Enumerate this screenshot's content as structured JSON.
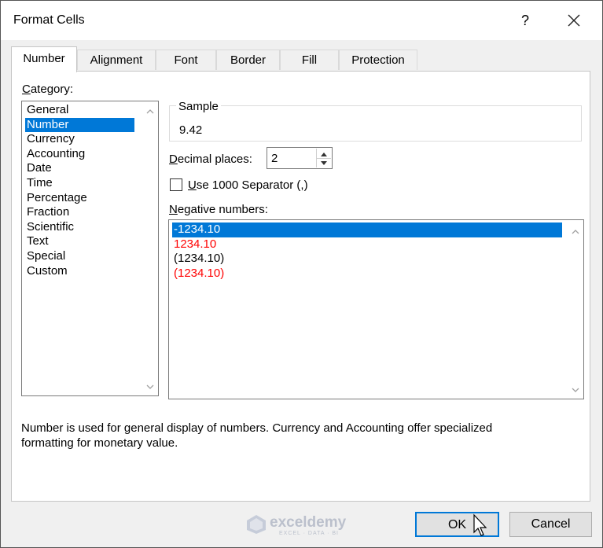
{
  "window": {
    "title": "Format Cells",
    "help_label": "?"
  },
  "tabs": [
    {
      "label": "Number",
      "active": true
    },
    {
      "label": "Alignment"
    },
    {
      "label": "Font"
    },
    {
      "label": "Border"
    },
    {
      "label": "Fill"
    },
    {
      "label": "Protection"
    }
  ],
  "category": {
    "label_prefix": "C",
    "label_rest": "ategory:",
    "items": [
      "General",
      "Number",
      "Currency",
      "Accounting",
      "Date",
      "Time",
      "Percentage",
      "Fraction",
      "Scientific",
      "Text",
      "Special",
      "Custom"
    ],
    "selected": "Number"
  },
  "sample": {
    "label": "Sample",
    "value": "9.42"
  },
  "decimal": {
    "label_prefix": "D",
    "label_rest": "ecimal places:",
    "value": "2"
  },
  "separator": {
    "label_prefix": "U",
    "label_rest": "se 1000 Separator (,)",
    "checked": false
  },
  "negative": {
    "label_prefix": "N",
    "label_rest": "egative numbers:",
    "items": [
      {
        "text": "-1234.10",
        "color": "#000000",
        "selected": true
      },
      {
        "text": "1234.10",
        "color": "#ff0000"
      },
      {
        "text": "(1234.10)",
        "color": "#000000"
      },
      {
        "text": "(1234.10)",
        "color": "#ff0000"
      }
    ]
  },
  "description": {
    "line1": "Number is used for general display of numbers.  Currency and Accounting offer specialized",
    "line2": "formatting for monetary value."
  },
  "buttons": {
    "ok": "OK",
    "cancel": "Cancel"
  },
  "watermark": {
    "name": "exceldemy",
    "tagline": "EXCEL · DATA · BI"
  },
  "colors": {
    "selection": "#0078d7",
    "negative_red": "#ff0000",
    "focus": "#0078d7"
  }
}
